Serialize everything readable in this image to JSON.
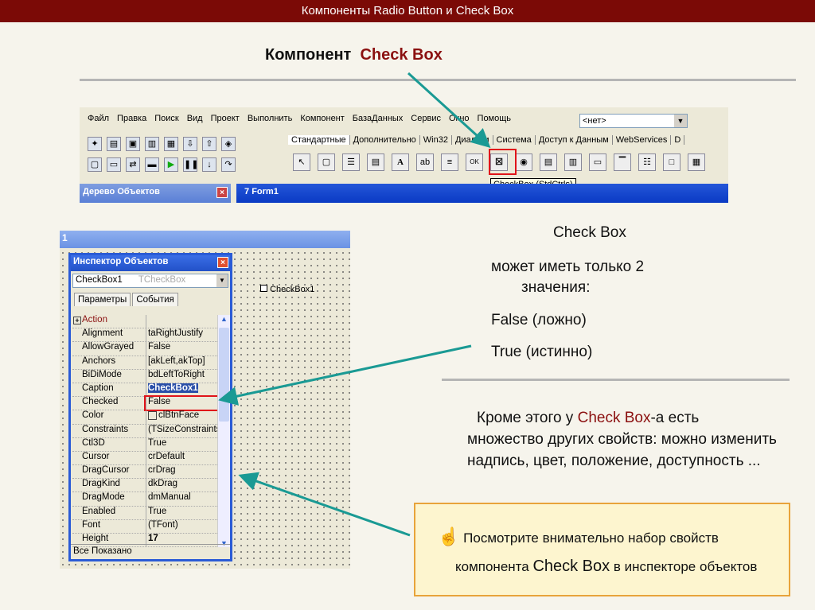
{
  "slide": {
    "title": "Компоненты  Radio Button и Check Box",
    "heading_prefix": "Компонент",
    "heading_highlight": "Check Box"
  },
  "ide": {
    "menu": [
      "Файл",
      "Правка",
      "Поиск",
      "Вид",
      "Проект",
      "Выполнить",
      "Компонент",
      "БазаДанных",
      "Сервис",
      "Окно",
      "Помощь"
    ],
    "combo_value": "<нет>",
    "palette_tabs": [
      "Стандартные",
      "Дополнительно",
      "Win32",
      "Диалоги",
      "Система",
      "Доступ к Данным",
      "WebServices",
      "D"
    ],
    "palette_icons": [
      "pointer-icon",
      "frames-icon",
      "mainmenu-icon",
      "popupmenu-icon",
      "label-icon",
      "edit-icon",
      "memo-icon",
      "button-icon",
      "checkbox-icon",
      "radiobutton-icon",
      "listbox-icon",
      "combobox-icon",
      "scrollbar-icon",
      "groupbox-icon",
      "radiogroup-icon",
      "panel-icon",
      "actionlist-icon"
    ],
    "tooltip": "CheckBox (StdCtrls)",
    "object_tree_title": "Дерево Объектов",
    "form_title": "Form1"
  },
  "inspector": {
    "form_bar": "1",
    "title": "Инспектор Объектов",
    "object_name": "CheckBox1",
    "object_type": "TCheckBox",
    "tabs": [
      "Параметры",
      "События"
    ],
    "properties": [
      {
        "name": "Action",
        "value": ""
      },
      {
        "name": "Alignment",
        "value": "taRightJustify"
      },
      {
        "name": "AllowGrayed",
        "value": "False"
      },
      {
        "name": "Anchors",
        "value": "[akLeft,akTop]",
        "expand": "+"
      },
      {
        "name": "BiDiMode",
        "value": "bdLeftToRight"
      },
      {
        "name": "Caption",
        "value": "CheckBox1"
      },
      {
        "name": "Checked",
        "value": "False"
      },
      {
        "name": "Color",
        "value": "clBtnFace"
      },
      {
        "name": "Constraints",
        "value": "(TSizeConstraints)",
        "expand": "+"
      },
      {
        "name": "Ctl3D",
        "value": "True"
      },
      {
        "name": "Cursor",
        "value": "crDefault"
      },
      {
        "name": "DragCursor",
        "value": "crDrag"
      },
      {
        "name": "DragKind",
        "value": "dkDrag"
      },
      {
        "name": "DragMode",
        "value": "dmManual"
      },
      {
        "name": "Enabled",
        "value": "True"
      },
      {
        "name": "Font",
        "value": "(TFont)",
        "expand": "+"
      },
      {
        "name": "Height",
        "value": "17"
      }
    ],
    "status": "Все Показано",
    "form_checkbox_caption": "CheckBox1"
  },
  "right": {
    "title": "Check Box",
    "line1": "может иметь только 2",
    "line2": "значения:",
    "false_text": "False (ложно)",
    "true_text": "True (истинно)",
    "para_1": "Кроме этого у ",
    "para_hl": "Check Box",
    "para_2": "-а есть множество других свойств: можно изменить надпись,  цвет, положение, доступность ...",
    "note_1": "Посмотрите внимательно набор свойств",
    "note_2": "компонента ",
    "note_hl": "Check Box",
    "note_3": " в инспекторе объектов"
  },
  "colors": {
    "header": "#7b0a06",
    "accent": "#8b1010",
    "arrow": "#1a9a94",
    "highlight_box": "#e0141a"
  }
}
